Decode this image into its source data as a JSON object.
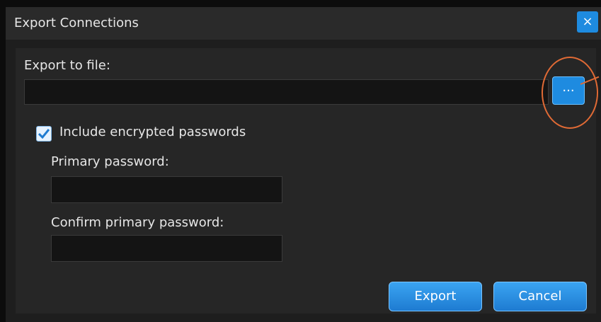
{
  "dialog": {
    "title": "Export Connections",
    "close_label": "×"
  },
  "export_file": {
    "label": "Export to file:",
    "value": "",
    "browse_label": "..."
  },
  "include_passwords": {
    "label": "Include encrypted passwords",
    "checked": true
  },
  "primary_password": {
    "label": "Primary password:",
    "value": ""
  },
  "confirm_password": {
    "label": "Confirm primary password:",
    "value": ""
  },
  "buttons": {
    "export_label": "Export",
    "cancel_label": "Cancel"
  },
  "colors": {
    "accent": "#1e8be0",
    "annotation": "#e06a35"
  }
}
